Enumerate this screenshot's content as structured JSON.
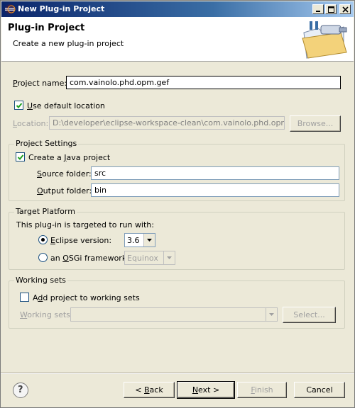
{
  "window": {
    "title": "New Plug-in Project",
    "controls": {
      "minimize": "minimize-icon",
      "maximize": "maximize-icon",
      "close": "close-icon"
    }
  },
  "banner": {
    "heading": "Plug-in Project",
    "description": "Create a new plug-in project"
  },
  "project": {
    "name_label_u": "P",
    "name_label_rest": "roject name:",
    "name_value": "com.vainolo.phd.opm.gef",
    "use_default_label_u": "U",
    "use_default_label_rest": "se default location",
    "use_default_checked": true,
    "location_label_u": "L",
    "location_label_rest": "ocation:",
    "location_value": "D:\\developer\\eclipse-workspace-clean\\com.vainolo.phd.opm.gef",
    "browse_label": "Browse..."
  },
  "project_settings": {
    "title": "Project Settings",
    "java_label_pre": "Create a ",
    "java_label_u": "J",
    "java_label_rest": "ava project",
    "java_checked": true,
    "source_label_u": "S",
    "source_label_rest": "ource folder:",
    "source_value": "src",
    "output_label_u": "O",
    "output_label_rest": "utput folder:",
    "output_value": "bin"
  },
  "target_platform": {
    "title": "Target Platform",
    "intro": "This plug-in is targeted to run with:",
    "eclipse_label_u": "E",
    "eclipse_label_rest": "clipse version:",
    "eclipse_selected": true,
    "eclipse_version": "3.6",
    "osgi_label_pre": "an ",
    "osgi_label_u": "O",
    "osgi_label_rest": "SGi framework:",
    "osgi_value": "Equinox"
  },
  "working_sets": {
    "title": "Working sets",
    "add_label_pre": "A",
    "add_label_u": "d",
    "add_label_rest": "d project to working sets",
    "add_checked": false,
    "sets_label_u": "W",
    "sets_label_rest": "orking sets:",
    "sets_value": "",
    "select_label": "Select..."
  },
  "footer": {
    "help_glyph": "?",
    "back_pre": "< ",
    "back_u": "B",
    "back_rest": "ack",
    "next_u": "N",
    "next_rest": "ext >",
    "finish_u": "F",
    "finish_rest": "inish",
    "cancel_label": "Cancel"
  }
}
